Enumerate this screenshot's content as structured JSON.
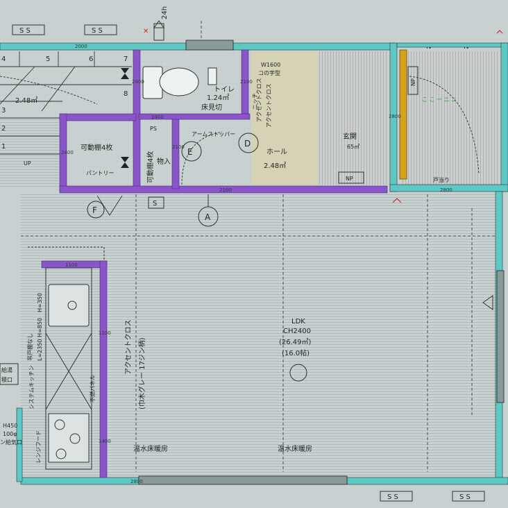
{
  "colors": {
    "background": "#c9d1d1",
    "exterior_wall": "#5ec8c4",
    "interior_wall": "#8a55c8",
    "door_accent": "#d6a21a",
    "hatch_area": "#d8d2b0",
    "line": "#2b3333"
  },
  "grid_marks": {
    "ss_top_left_1": "S S",
    "ss_top_left_2": "S S",
    "ss_bottom_1": "S S",
    "ss_bottom_2": "S S",
    "s_mark": "S",
    "n_mark_1": "N",
    "n_mark_2": "N"
  },
  "vent": {
    "label": "24h"
  },
  "stairs": {
    "numbers": [
      "4",
      "5",
      "6",
      "7",
      "8",
      "3",
      "2",
      "1"
    ],
    "area": "2.48㎡",
    "up_label": "UP"
  },
  "toilet": {
    "name": "トイレ",
    "area": "1.24㎡",
    "floor_note": "床見切",
    "accent_cloth": "アクセントクロス"
  },
  "closet_top": {
    "label": "W1600",
    "label2": "コの字型"
  },
  "genkan": {
    "name": "玄関",
    "area": "65㎡",
    "np": "NP"
  },
  "hall": {
    "name": "ホール",
    "area": "2.48㎡",
    "door_stopper": "アームストッパー",
    "accent_cloth": "アクセントクロス",
    "niche": "ニッチ"
  },
  "pantry": {
    "shelf": "可動棚4枚",
    "name": "パントリー"
  },
  "storage": {
    "shelf": "可動棚4枚",
    "name": "物入",
    "ps": "PS"
  },
  "markers": {
    "A": "A",
    "D": "D",
    "E": "E",
    "F": "F"
  },
  "ldk": {
    "name": "LDK",
    "ceiling": "CH2400",
    "area": "(26.49㎡)",
    "tatami": "(16.0帖)",
    "floor_heating_1": "温水床暖房",
    "floor_heating_2": "温水床暖房",
    "accent_cloth": "アクセントクロス",
    "accent_cloth_note": "(巾木グレー 17ジン柄)"
  },
  "kitchen": {
    "hood_note": "レンジフード",
    "counter_note": "システムキッチン",
    "size_note": "L=2350 H=850",
    "panel_note": "不燃パネル",
    "no_cabinet": "吊戸棚なし",
    "dims": "H=350"
  },
  "left_labels": {
    "h450": "H450",
    "phi100": "100φ",
    "vent": "ン給気口",
    "box_a": "給湯",
    "box_b": "積口"
  },
  "right_room": {
    "np": "NP",
    "cloth_note": "こ こ ー ニ ニ",
    "door_note": "戸当り",
    "dims": "2800"
  },
  "dimensions": {
    "d2000": "2000",
    "d2400a": "2400",
    "d2400b": "2400",
    "d2100a": "2100",
    "d2100b": "2100",
    "d2100c": "2100",
    "d2800a": "2800",
    "d2800b": "2800",
    "d2800c": "2800",
    "d1100a": "1100",
    "d1100b": "1100",
    "d1400": "1400",
    "d2400c": "2400"
  }
}
